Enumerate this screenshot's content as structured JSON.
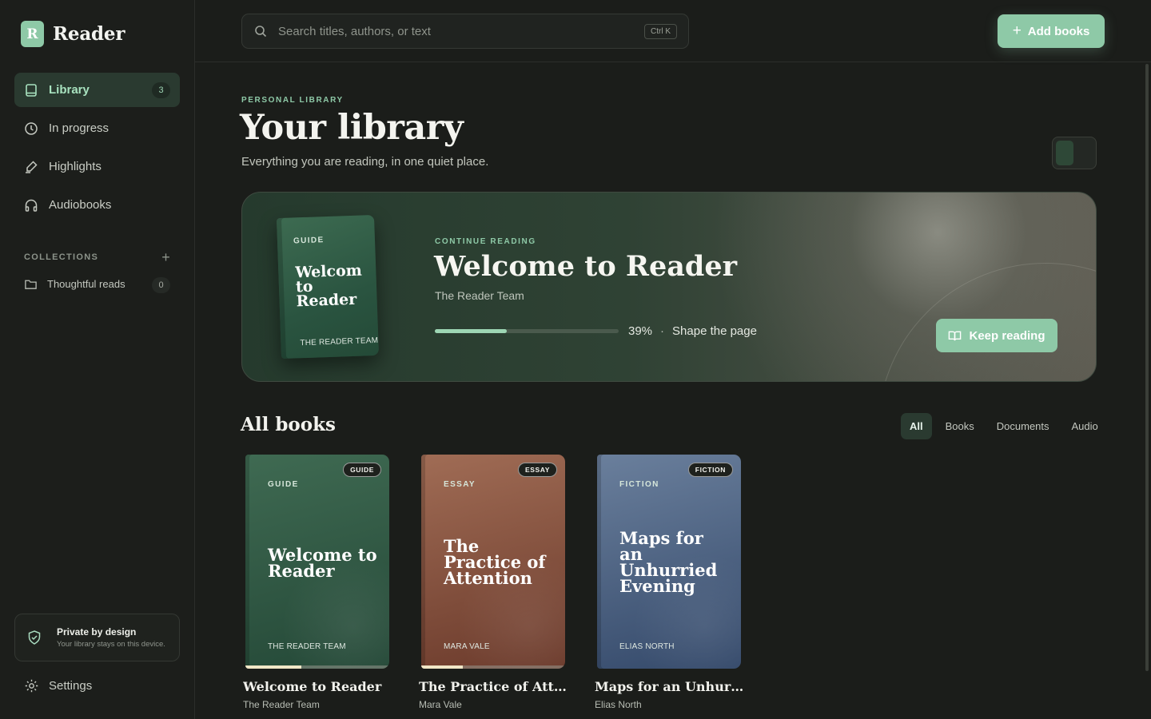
{
  "brand": {
    "logo_letter": "R",
    "name": "Reader"
  },
  "sidebar": {
    "nav": [
      {
        "label": "Library",
        "icon": "book-icon",
        "badge": "3",
        "active": true
      },
      {
        "label": "In progress",
        "icon": "clock-icon"
      },
      {
        "label": "Highlights",
        "icon": "highlighter-icon"
      },
      {
        "label": "Audiobooks",
        "icon": "headphones-icon"
      }
    ],
    "collections_label": "COLLECTIONS",
    "collections": [
      {
        "label": "Thoughtful reads",
        "count": "0",
        "icon": "folder-icon"
      }
    ],
    "privacy": {
      "title": "Private by design",
      "subtitle": "Your library stays on this device.",
      "icon": "shield-check-icon"
    },
    "settings_label": "Settings"
  },
  "topbar": {
    "search_placeholder": "Search titles, authors, or text",
    "search_shortcut": "Ctrl K",
    "add_books_label": "Add books"
  },
  "page": {
    "eyebrow": "PERSONAL LIBRARY",
    "title": "Your library",
    "subtitle": "Everything you are reading, in one quiet place."
  },
  "hero": {
    "eyebrow": "CONTINUE READING",
    "title": "Welcome to Reader",
    "author": "The Reader Team",
    "progress_percent": 39,
    "progress_label": "39%",
    "separator": "·",
    "chapter": "Shape the page",
    "button_label": "Keep reading",
    "cover": {
      "genre": "GUIDE",
      "title": "Welcom to Reader",
      "author": "THE READER TEAM",
      "color": "#2f5a44"
    }
  },
  "books_section": {
    "title": "All books",
    "filters": [
      "All",
      "Books",
      "Documents",
      "Audio"
    ],
    "active_filter": "All",
    "books": [
      {
        "tag": "GUIDE",
        "genre": "GUIDE",
        "cover_title": "Welcome to Reader",
        "cover_author": "THE READER TEAM",
        "name": "Welcome to Reader",
        "author": "The Reader Team",
        "progress": 0.39,
        "colors": [
          "#3f6a52",
          "#244837"
        ]
      },
      {
        "tag": "ESSAY",
        "genre": "ESSAY",
        "cover_title": "The Practice of Attention",
        "cover_author": "MARA VALE",
        "name": "The Practice of Atte...",
        "author": "Mara Vale",
        "progress": 0.29,
        "colors": [
          "#a06c55",
          "#6b3a2b"
        ]
      },
      {
        "tag": "FICTION",
        "genre": "FICTION",
        "cover_title": "Maps for an Unhurried Evening",
        "cover_author": "ELIAS NORTH",
        "name": "Maps for an Unhurri...",
        "author": "Elias North",
        "progress": 0,
        "colors": [
          "#6a7f9c",
          "#34496a"
        ]
      }
    ]
  },
  "colors": {
    "accent": "#8ec9a7",
    "background": "#1b1d1a",
    "active_nav": "#2a3a30"
  }
}
